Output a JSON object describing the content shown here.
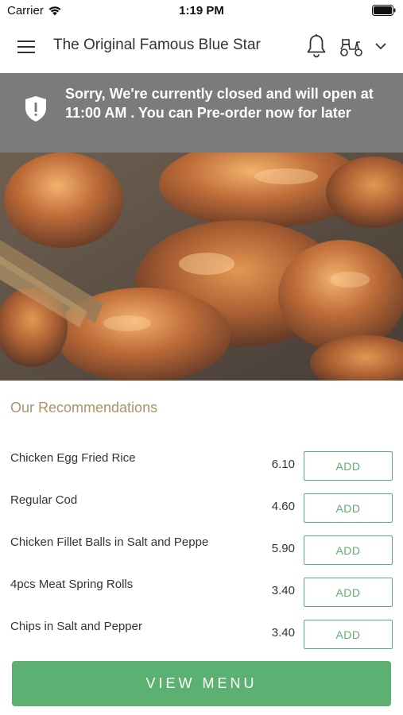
{
  "status_bar": {
    "carrier": "Carrier",
    "time": "1:19 PM"
  },
  "header": {
    "title": "The Original Famous Blue Star",
    "icons": [
      "menu-icon",
      "bell-icon",
      "scooter-icon",
      "chevron-down-icon"
    ]
  },
  "banner": {
    "icon": "shield-alert-icon",
    "message": "Sorry, We're currently closed and will open at 11:00 AM . You can Pre-order now for later"
  },
  "recommendations": {
    "title": "Our Recommendations",
    "items": [
      {
        "name": "Chicken Egg Fried Rice",
        "price": "6.10",
        "button": "ADD"
      },
      {
        "name": "Regular Cod",
        "price": "4.60",
        "button": "ADD"
      },
      {
        "name": "Chicken Fillet Balls in Salt and Peppe",
        "price": "5.90",
        "button": "ADD"
      },
      {
        "name": "4pcs Meat Spring Rolls",
        "price": "3.40",
        "button": "ADD"
      },
      {
        "name": "Chips in Salt and Pepper",
        "price": "3.40",
        "button": "ADD"
      }
    ]
  },
  "footer": {
    "button": "VIEW MENU"
  },
  "colors": {
    "accent_green": "#5cb172",
    "banner_gray": "#7b7b7b",
    "section_title": "#a89467"
  }
}
